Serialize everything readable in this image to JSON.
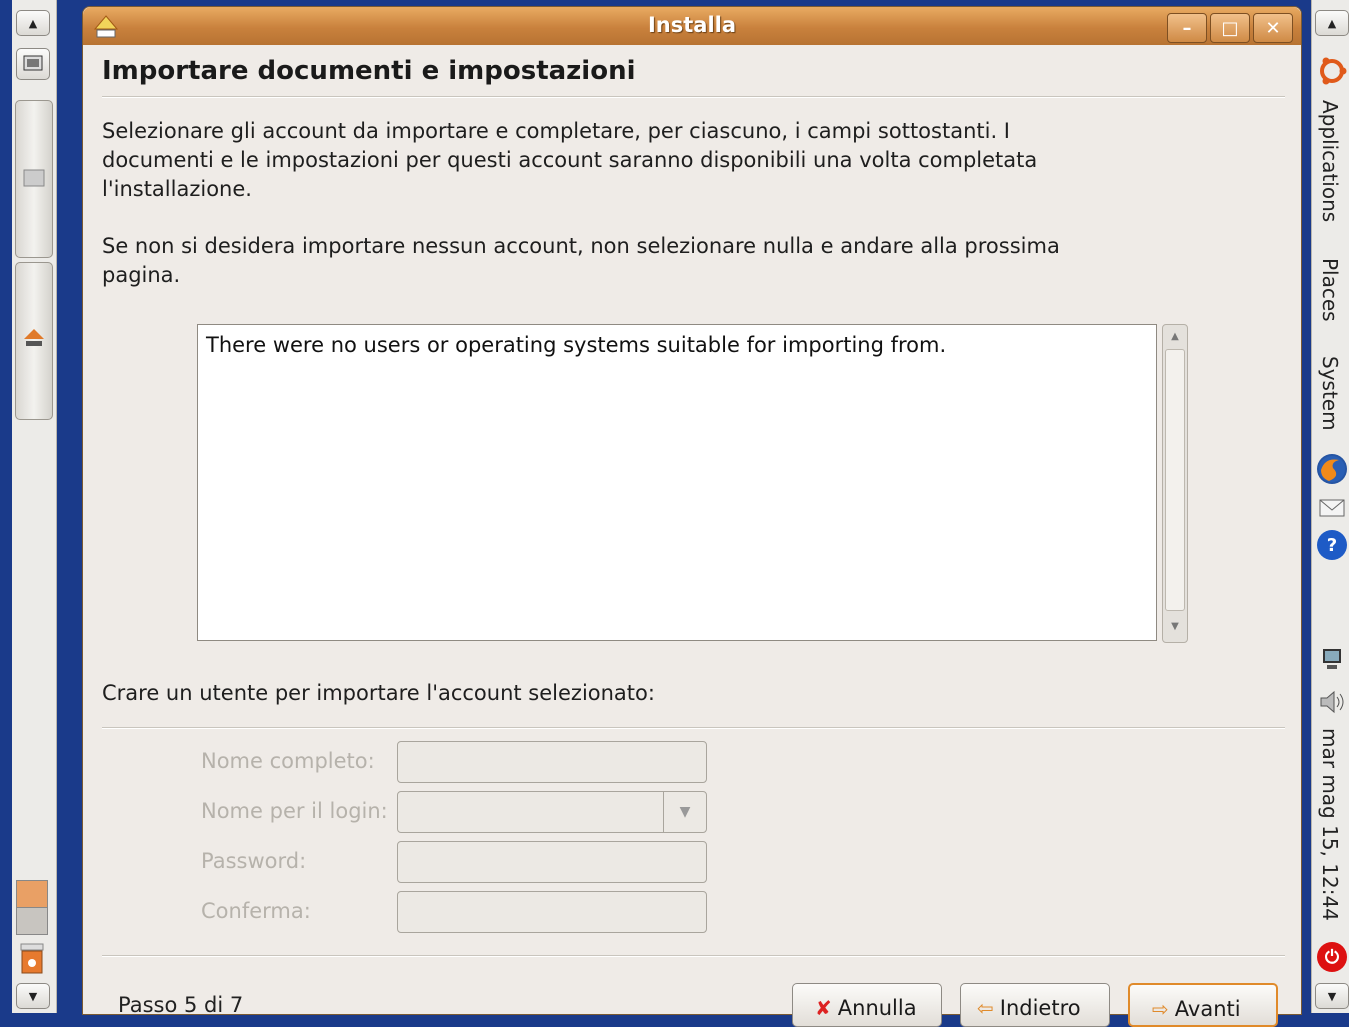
{
  "window": {
    "title": "Installa",
    "minimize_label": "–",
    "maximize_label": "□",
    "close_label": "✕"
  },
  "page": {
    "heading": "Importare documenti e impostazioni",
    "intro": "Selezionare gli account da importare e completare, per ciascuno, i campi sottostanti. I documenti e le impostazioni per questi account saranno disponibili una volta completata l'installazione.",
    "skip_note": "Se non si desidera importare nessun account, non selezionare nulla e andare alla prossima pagina.",
    "list_message": "There were no users or operating systems suitable for importing from.",
    "create_user_label": "Crare un utente per importare l'account selezionato:"
  },
  "form": {
    "full_name_label": "Nome completo:",
    "login_name_label": "Nome per il login:",
    "password_label": "Password:",
    "confirm_label": "Conferma:",
    "full_name_value": "",
    "login_name_value": "",
    "password_value": "",
    "confirm_value": ""
  },
  "footer": {
    "step_text": "Passo 5 di 7",
    "cancel_label": "Annulla",
    "back_label": "Indietro",
    "forward_label": "Avanti"
  },
  "right_panel": {
    "applications": "Applications",
    "places": "Places",
    "system": "System",
    "clock": "mar mag 15, 12:44"
  },
  "icons": {
    "ubuntu_logo": "ubuntu-logo-icon",
    "firefox": "firefox-icon",
    "mail": "mail-icon",
    "help": "help-icon",
    "network": "network-icon",
    "volume": "volume-icon",
    "power": "power-icon"
  }
}
